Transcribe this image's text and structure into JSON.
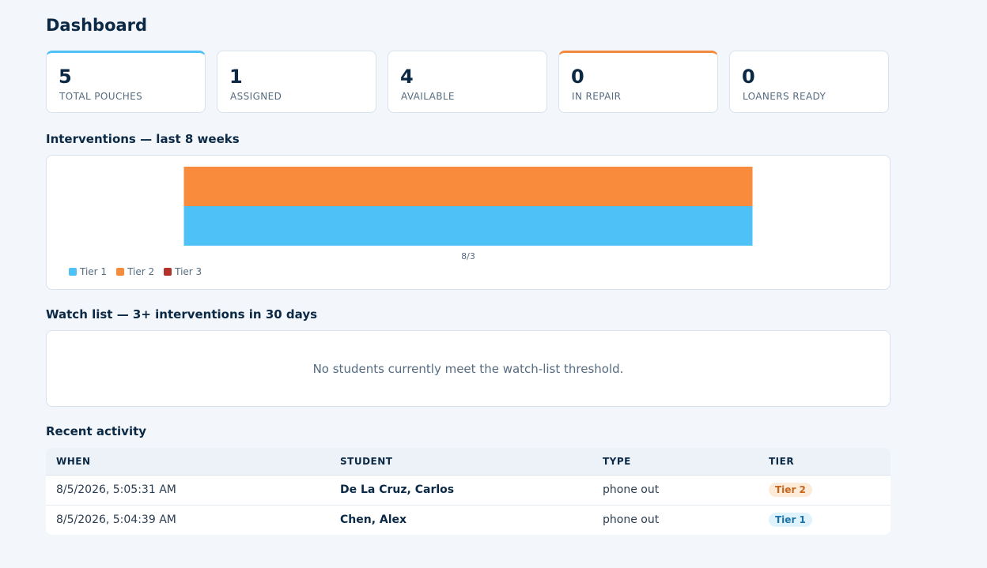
{
  "page": {
    "title": "Dashboard"
  },
  "stats": [
    {
      "value": "5",
      "label": "TOTAL POUCHES"
    },
    {
      "value": "1",
      "label": "ASSIGNED"
    },
    {
      "value": "4",
      "label": "AVAILABLE"
    },
    {
      "value": "0",
      "label": "IN REPAIR"
    },
    {
      "value": "0",
      "label": "LOANERS READY"
    }
  ],
  "colors": {
    "tier1": "#4ec2f7",
    "tier2": "#f98b3c",
    "tier3": "#b3322c",
    "accent_blue": "#4ec2f7",
    "accent_orange": "#f3893d"
  },
  "interventions": {
    "heading": "Interventions — last 8 weeks"
  },
  "chart_data": {
    "type": "bar",
    "stacked": true,
    "categories": [
      "8/3"
    ],
    "series": [
      {
        "name": "Tier 1",
        "values": [
          1
        ]
      },
      {
        "name": "Tier 2",
        "values": [
          1
        ]
      },
      {
        "name": "Tier 3",
        "values": [
          0
        ]
      }
    ],
    "legend": "bottom-left",
    "grid": false
  },
  "watchlist": {
    "heading": "Watch list — 3+ interventions in 30 days",
    "empty_message": "No students currently meet the watch-list threshold."
  },
  "recent": {
    "heading": "Recent activity",
    "columns": [
      "WHEN",
      "STUDENT",
      "TYPE",
      "TIER"
    ],
    "rows": [
      {
        "when": "8/5/2026, 5:05:31 AM",
        "student": "De La Cruz, Carlos",
        "type": "phone out",
        "tier": "Tier 2"
      },
      {
        "when": "8/5/2026, 5:04:39 AM",
        "student": "Chen, Alex",
        "type": "phone out",
        "tier": "Tier 1"
      }
    ]
  }
}
